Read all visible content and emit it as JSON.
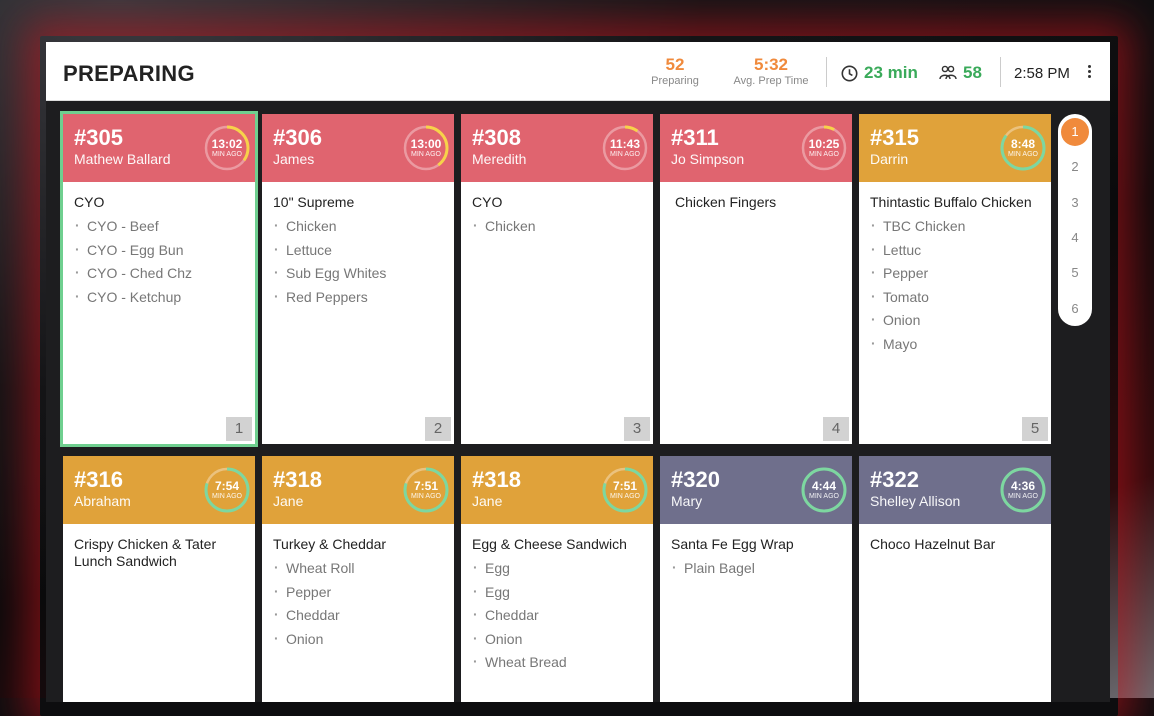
{
  "header": {
    "title": "PREPARING",
    "preparing_count": "52",
    "preparing_label": "Preparing",
    "avg_prep_time": "5:32",
    "avg_prep_label": "Avg. Prep Time",
    "wait_time": "23 min",
    "guests": "58",
    "clock": "2:58 PM"
  },
  "colors": {
    "red": "#e0646f",
    "orange": "#e0a23a",
    "purple": "#6f6f8c",
    "accent": "#f08a3c",
    "green": "#3aaa5a"
  },
  "orders": [
    {
      "number": "#305",
      "name": "Mathew Ballard",
      "timer": "13:02",
      "timer_sub": "MIN AGO",
      "color": "red",
      "item": "CYO",
      "mods": [
        "CYO - Beef",
        "CYO - Egg Bun",
        "CYO - Ched Chz",
        "CYO - Ketchup"
      ],
      "position": "1",
      "selected": true,
      "progress": 0.35
    },
    {
      "number": "#306",
      "name": "James",
      "timer": "13:00",
      "timer_sub": "MIN AGO",
      "color": "red",
      "item": "10\" Supreme",
      "mods": [
        "Chicken",
        "Lettuce",
        "Sub Egg Whites",
        "Red Peppers"
      ],
      "position": "2",
      "progress": 0.4
    },
    {
      "number": "#308",
      "name": "Meredith",
      "timer": "11:43",
      "timer_sub": "MIN AGO",
      "color": "red",
      "item": "CYO",
      "mods": [
        "Chicken"
      ],
      "position": "3",
      "progress": 0.1
    },
    {
      "number": "#311",
      "name": "Jo Simpson",
      "timer": "10:25",
      "timer_sub": "MIN AGO",
      "color": "red",
      "item": "Chicken Fingers",
      "mods": [],
      "position": "4",
      "progress": 0.08
    },
    {
      "number": "#315",
      "name": "Darrin",
      "timer": "8:48",
      "timer_sub": "MIN AGO",
      "color": "orange",
      "item": "Thintastic Buffalo Chicken",
      "mods": [
        "TBC Chicken",
        "Lettuc",
        "Pepper",
        "Tomato",
        "Onion",
        "Mayo"
      ],
      "position": "5",
      "progress": 0.85
    },
    {
      "number": "#316",
      "name": "Abraham",
      "timer": "7:54",
      "timer_sub": "MIN AGO",
      "color": "orange",
      "item": "Crispy Chicken & Tater Lunch Sandwich",
      "mods": [],
      "position": "",
      "progress": 0.8
    },
    {
      "number": "#318",
      "name": "Jane",
      "timer": "7:51",
      "timer_sub": "MIN AGO",
      "color": "orange",
      "item": "Turkey & Cheddar",
      "mods": [
        "Wheat Roll",
        "Pepper",
        "Cheddar",
        "Onion"
      ],
      "position": "",
      "progress": 0.8
    },
    {
      "number": "#318",
      "name": "Jane",
      "timer": "7:51",
      "timer_sub": "MIN AGO",
      "color": "orange",
      "item": "Egg & Cheese Sandwich",
      "mods": [
        "Egg",
        "Egg",
        "Cheddar",
        "Onion",
        "Wheat Bread"
      ],
      "position": "",
      "progress": 0.8
    },
    {
      "number": "#320",
      "name": "Mary",
      "timer": "4:44",
      "timer_sub": "MIN AGO",
      "color": "purple",
      "item": "Santa Fe Egg Wrap",
      "mods": [
        "Plain Bagel"
      ],
      "position": "",
      "progress": 1.0
    },
    {
      "number": "#322",
      "name": "Shelley Allison",
      "timer": "4:36",
      "timer_sub": "MIN AGO",
      "color": "purple",
      "item": "Choco Hazelnut Bar",
      "mods": [],
      "position": "",
      "progress": 1.0
    }
  ],
  "pager": {
    "pages": [
      "1",
      "2",
      "3",
      "4",
      "5",
      "6"
    ],
    "active": "1"
  }
}
